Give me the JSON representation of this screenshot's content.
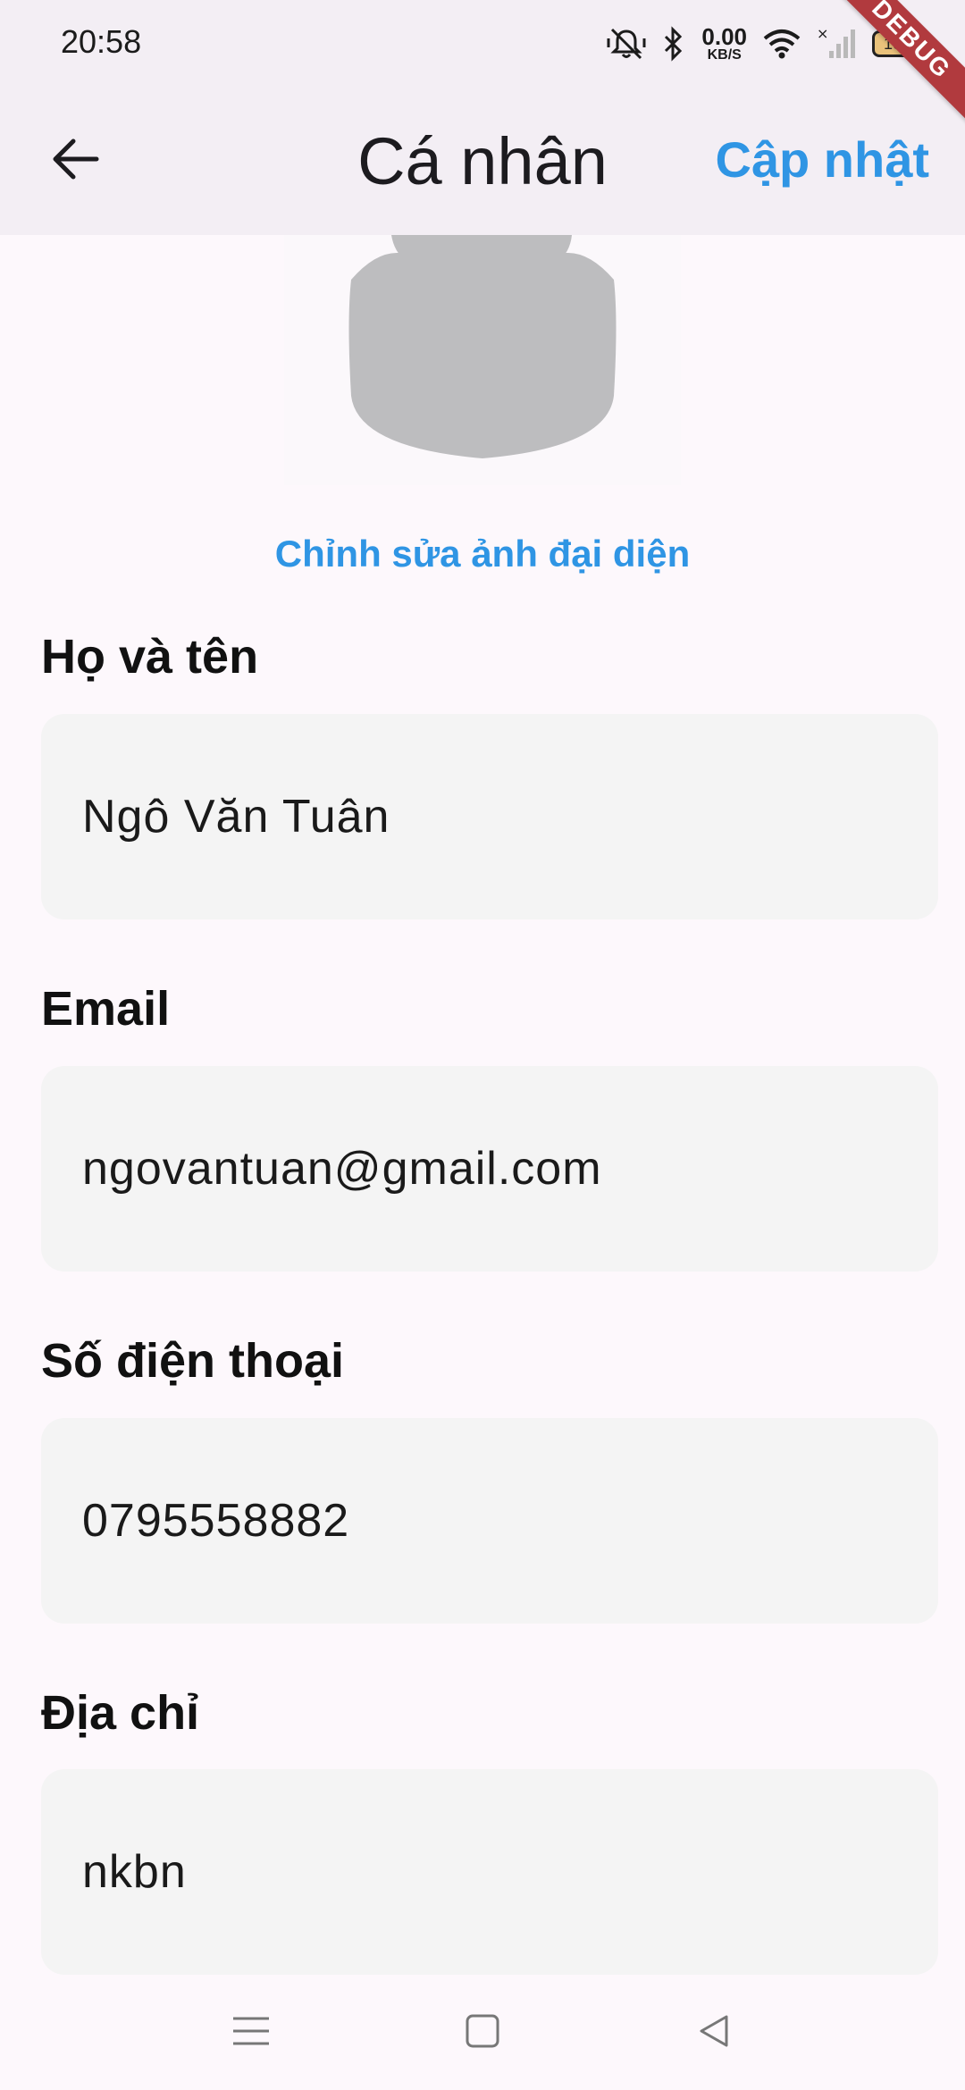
{
  "status_bar": {
    "time": "20:58",
    "net_speed_value": "0.00",
    "net_speed_unit": "KB/S",
    "battery": "100"
  },
  "debug_banner": "DEBUG",
  "app_bar": {
    "title": "Cá nhân",
    "update_label": "Cập nhật"
  },
  "avatar": {
    "edit_label": "Chỉnh sửa ảnh đại diện"
  },
  "form": {
    "fields": [
      {
        "label": "Họ và tên",
        "value": "Ngô Văn Tuân"
      },
      {
        "label": "Email",
        "value": "ngovantuan@gmail.com"
      },
      {
        "label": "Số điện thoại",
        "value": "0795558882"
      },
      {
        "label": "Địa chỉ",
        "value": "nkbn"
      }
    ]
  },
  "colors": {
    "accent": "#2f95e4",
    "app_bar_bg": "#f3eef4",
    "page_bg": "#fdf8fc",
    "field_bg": "#f4f4f4",
    "avatar_placeholder": "#bdbdbf",
    "debug_ribbon": "#b13a3e"
  }
}
